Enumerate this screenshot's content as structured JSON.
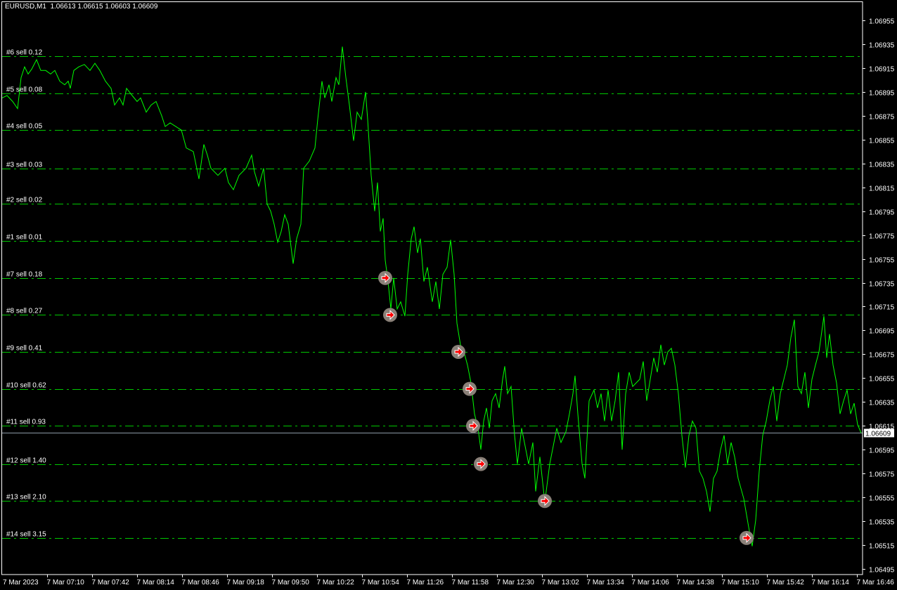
{
  "header": {
    "symbol": "EURUSD,M1",
    "ohlc": "1.06613 1.06615 1.06603 1.06609"
  },
  "colors": {
    "background": "#000000",
    "price_line": "#00ff00",
    "order_line": "#00c800",
    "axis": "#ffffff",
    "bid_line": "#8c9aa6",
    "marker_fill": "#8a8078",
    "marker_arrow": "#ff0000"
  },
  "chart_data": {
    "type": "line",
    "title": "EURUSD,M1",
    "x_unit": "minutes after 7 Mar 2023 06:38",
    "xlim": [
      0,
      611
    ],
    "ylim": [
      1.06485,
      1.06972
    ],
    "grid": false,
    "current_price": "1.06609",
    "y_ticks": [
      "1.06955",
      "1.06935",
      "1.06915",
      "1.06895",
      "1.06875",
      "1.06855",
      "1.06835",
      "1.06815",
      "1.06795",
      "1.06775",
      "1.06755",
      "1.06735",
      "1.06715",
      "1.06695",
      "1.06675",
      "1.06655",
      "1.06635",
      "1.06615",
      "1.06595",
      "1.06575",
      "1.06555",
      "1.06535",
      "1.06515",
      "1.06495"
    ],
    "x_ticks": [
      {
        "t": 0,
        "label": "7 Mar 2023"
      },
      {
        "t": 32,
        "label": "7 Mar 07:10"
      },
      {
        "t": 64,
        "label": "7 Mar 07:42"
      },
      {
        "t": 96,
        "label": "7 Mar 08:14"
      },
      {
        "t": 128,
        "label": "7 Mar 08:46"
      },
      {
        "t": 160,
        "label": "7 Mar 09:18"
      },
      {
        "t": 192,
        "label": "7 Mar 09:50"
      },
      {
        "t": 224,
        "label": "7 Mar 10:22"
      },
      {
        "t": 256,
        "label": "7 Mar 10:54"
      },
      {
        "t": 288,
        "label": "7 Mar 11:26"
      },
      {
        "t": 320,
        "label": "7 Mar 11:58"
      },
      {
        "t": 352,
        "label": "7 Mar 12:30"
      },
      {
        "t": 384,
        "label": "7 Mar 13:02"
      },
      {
        "t": 416,
        "label": "7 Mar 13:34"
      },
      {
        "t": 448,
        "label": "7 Mar 14:06"
      },
      {
        "t": 480,
        "label": "7 Mar 14:38"
      },
      {
        "t": 512,
        "label": "7 Mar 15:10"
      },
      {
        "t": 544,
        "label": "7 Mar 15:42"
      },
      {
        "t": 576,
        "label": "7 Mar 16:14"
      },
      {
        "t": 608,
        "label": "7 Mar 16:46"
      }
    ],
    "orders": [
      {
        "label": "#6 sell 0.12",
        "price": 1.06925
      },
      {
        "label": "#5 sell 0.08",
        "price": 1.06894
      },
      {
        "label": "#4 sell 0.05",
        "price": 1.06863
      },
      {
        "label": "#3 sell 0.03",
        "price": 1.06831
      },
      {
        "label": "#2 sell 0.02",
        "price": 1.06801
      },
      {
        "label": "#1 sell 0.01",
        "price": 1.0677
      },
      {
        "label": "#7 sell 0.18",
        "price": 1.06739
      },
      {
        "label": "#8 sell 0.27",
        "price": 1.06708
      },
      {
        "label": "#9 sell 0.41",
        "price": 1.06677
      },
      {
        "label": "#10 sell 0.62",
        "price": 1.06646
      },
      {
        "label": "#11 sell 0.93",
        "price": 1.06615
      },
      {
        "label": "#12 sell 1.40",
        "price": 1.06583
      },
      {
        "label": "#13 sell 2.10",
        "price": 1.06552
      },
      {
        "label": "#14 sell 3.15",
        "price": 1.06521
      }
    ],
    "entries": [
      {
        "t": 272.5,
        "price": 1.06739
      },
      {
        "t": 276,
        "price": 1.06708
      },
      {
        "t": 324.5,
        "price": 1.06677
      },
      {
        "t": 332.5,
        "price": 1.06646
      },
      {
        "t": 335,
        "price": 1.06615
      },
      {
        "t": 340.5,
        "price": 1.06583
      },
      {
        "t": 386,
        "price": 1.06552
      },
      {
        "t": 529.5,
        "price": 1.06521
      }
    ],
    "series": [
      {
        "name": "EURUSD close",
        "points": [
          [
            0,
            1.0689
          ],
          [
            3.5,
            1.06892
          ],
          [
            7.5,
            1.06887
          ],
          [
            11,
            1.06881
          ],
          [
            13.5,
            1.06907
          ],
          [
            16,
            1.06916
          ],
          [
            18.5,
            1.0691
          ],
          [
            21,
            1.06914
          ],
          [
            24.5,
            1.06922
          ],
          [
            27.5,
            1.06913
          ],
          [
            31,
            1.06913
          ],
          [
            34.5,
            1.0691
          ],
          [
            37.5,
            1.06913
          ],
          [
            41,
            1.06904
          ],
          [
            44.5,
            1.06901
          ],
          [
            47,
            1.06904
          ],
          [
            48.5,
            1.06898
          ],
          [
            51,
            1.06913
          ],
          [
            54.5,
            1.06916
          ],
          [
            58.5,
            1.06918
          ],
          [
            62.5,
            1.06913
          ],
          [
            66,
            1.06919
          ],
          [
            69.5,
            1.06913
          ],
          [
            73.5,
            1.06904
          ],
          [
            77.5,
            1.06898
          ],
          [
            80,
            1.06884
          ],
          [
            83.5,
            1.0689
          ],
          [
            86,
            1.06884
          ],
          [
            88.5,
            1.06898
          ],
          [
            92.5,
            1.06892
          ],
          [
            96,
            1.06887
          ],
          [
            98.5,
            1.0689
          ],
          [
            102.5,
            1.06878
          ],
          [
            106,
            1.06884
          ],
          [
            109.5,
            1.06887
          ],
          [
            113.5,
            1.06875
          ],
          [
            116,
            1.06866
          ],
          [
            119.5,
            1.06869
          ],
          [
            123.5,
            1.06866
          ],
          [
            127.5,
            1.06863
          ],
          [
            131,
            1.06848
          ],
          [
            136,
            1.06845
          ],
          [
            140,
            1.06822
          ],
          [
            143.5,
            1.06851
          ],
          [
            146,
            1.06842
          ],
          [
            148.5,
            1.06831
          ],
          [
            153.5,
            1.06825
          ],
          [
            158.5,
            1.06831
          ],
          [
            161,
            1.06819
          ],
          [
            164.5,
            1.06813
          ],
          [
            168.5,
            1.06825
          ],
          [
            173.5,
            1.06831
          ],
          [
            177.5,
            1.06842
          ],
          [
            179.5,
            1.06828
          ],
          [
            182.5,
            1.06816
          ],
          [
            186,
            1.06831
          ],
          [
            188.5,
            1.06801
          ],
          [
            191,
            1.06795
          ],
          [
            193.5,
            1.06784
          ],
          [
            196,
            1.06769
          ],
          [
            198.5,
            1.06778
          ],
          [
            201,
            1.06792
          ],
          [
            203.5,
            1.06784
          ],
          [
            207,
            1.06751
          ],
          [
            209.5,
            1.06772
          ],
          [
            212.5,
            1.06784
          ],
          [
            214.5,
            1.06831
          ],
          [
            218.5,
            1.06837
          ],
          [
            222.5,
            1.06848
          ],
          [
            224.5,
            1.06872
          ],
          [
            227.5,
            1.06904
          ],
          [
            229.5,
            1.0689
          ],
          [
            232.5,
            1.06901
          ],
          [
            234.5,
            1.06887
          ],
          [
            237.5,
            1.06907
          ],
          [
            239.5,
            1.06901
          ],
          [
            242,
            1.06933
          ],
          [
            244.5,
            1.06907
          ],
          [
            247,
            1.06884
          ],
          [
            250,
            1.06854
          ],
          [
            252.5,
            1.06878
          ],
          [
            255.5,
            1.06872
          ],
          [
            258.5,
            1.06895
          ],
          [
            260,
            1.06872
          ],
          [
            262.5,
            1.06825
          ],
          [
            265,
            1.06795
          ],
          [
            267,
            1.06819
          ],
          [
            269,
            1.06778
          ],
          [
            271,
            1.06789
          ],
          [
            272.5,
            1.06754
          ],
          [
            274.5,
            1.06736
          ],
          [
            276.5,
            1.06713
          ],
          [
            278.5,
            1.06739
          ],
          [
            281,
            1.06713
          ],
          [
            283.5,
            1.06719
          ],
          [
            286.5,
            1.06707
          ],
          [
            288.5,
            1.06742
          ],
          [
            291,
            1.06772
          ],
          [
            293,
            1.06782
          ],
          [
            295.5,
            1.0676
          ],
          [
            297.5,
            1.06772
          ],
          [
            300,
            1.06736
          ],
          [
            302.5,
            1.06748
          ],
          [
            306,
            1.06719
          ],
          [
            308.5,
            1.06736
          ],
          [
            311,
            1.06713
          ],
          [
            313.5,
            1.06742
          ],
          [
            316.5,
            1.06748
          ],
          [
            319,
            1.06771
          ],
          [
            321.5,
            1.06742
          ],
          [
            323.5,
            1.06701
          ],
          [
            326,
            1.06683
          ],
          [
            328.5,
            1.06677
          ],
          [
            331,
            1.06666
          ],
          [
            333.5,
            1.06651
          ],
          [
            336,
            1.06625
          ],
          [
            338.5,
            1.06613
          ],
          [
            340.5,
            1.06595
          ],
          [
            342.5,
            1.06619
          ],
          [
            344.5,
            1.0663
          ],
          [
            346.5,
            1.06613
          ],
          [
            348.5,
            1.06636
          ],
          [
            351,
            1.06642
          ],
          [
            353.5,
            1.0663
          ],
          [
            356,
            1.06654
          ],
          [
            357.5,
            1.06665
          ],
          [
            359.5,
            1.06642
          ],
          [
            362,
            1.06648
          ],
          [
            364.5,
            1.06607
          ],
          [
            366.5,
            1.06583
          ],
          [
            369.5,
            1.06613
          ],
          [
            372.5,
            1.06595
          ],
          [
            374.5,
            1.06583
          ],
          [
            377.5,
            1.06601
          ],
          [
            379.5,
            1.0656
          ],
          [
            382.5,
            1.06589
          ],
          [
            386,
            1.06551
          ],
          [
            389.5,
            1.06583
          ],
          [
            392.5,
            1.06601
          ],
          [
            394.5,
            1.06613
          ],
          [
            397.5,
            1.06601
          ],
          [
            401,
            1.0661
          ],
          [
            403.5,
            1.06625
          ],
          [
            406,
            1.06642
          ],
          [
            407.5,
            1.06657
          ],
          [
            409.5,
            1.06625
          ],
          [
            412.5,
            1.06583
          ],
          [
            414.5,
            1.06571
          ],
          [
            417.5,
            1.06636
          ],
          [
            421,
            1.06645
          ],
          [
            423.5,
            1.0663
          ],
          [
            426,
            1.06642
          ],
          [
            428.5,
            1.06619
          ],
          [
            431,
            1.06645
          ],
          [
            433.5,
            1.06619
          ],
          [
            436,
            1.06636
          ],
          [
            438.5,
            1.0666
          ],
          [
            441,
            1.06595
          ],
          [
            443.5,
            1.06642
          ],
          [
            446,
            1.0666
          ],
          [
            448.5,
            1.06648
          ],
          [
            451,
            1.06651
          ],
          [
            453.5,
            1.06654
          ],
          [
            456,
            1.06669
          ],
          [
            458.5,
            1.06636
          ],
          [
            461,
            1.06654
          ],
          [
            463.5,
            1.06672
          ],
          [
            466,
            1.0666
          ],
          [
            468.5,
            1.06683
          ],
          [
            471,
            1.06666
          ],
          [
            473.5,
            1.06677
          ],
          [
            476,
            1.0668
          ],
          [
            478.5,
            1.06666
          ],
          [
            481,
            1.06642
          ],
          [
            483.5,
            1.06607
          ],
          [
            486,
            1.0658
          ],
          [
            488.5,
            1.06607
          ],
          [
            491,
            1.06619
          ],
          [
            493.5,
            1.06613
          ],
          [
            496,
            1.06577
          ],
          [
            498.5,
            1.06571
          ],
          [
            501,
            1.0656
          ],
          [
            503.5,
            1.06543
          ],
          [
            506,
            1.06571
          ],
          [
            508.5,
            1.06577
          ],
          [
            511,
            1.06595
          ],
          [
            513.5,
            1.06607
          ],
          [
            516,
            1.06583
          ],
          [
            518.5,
            1.06601
          ],
          [
            521,
            1.06589
          ],
          [
            523.5,
            1.06571
          ],
          [
            527.5,
            1.06554
          ],
          [
            531,
            1.0653
          ],
          [
            533.5,
            1.06514
          ],
          [
            536,
            1.06536
          ],
          [
            538.5,
            1.06577
          ],
          [
            541,
            1.06607
          ],
          [
            543.5,
            1.06619
          ],
          [
            546,
            1.06636
          ],
          [
            548.5,
            1.06648
          ],
          [
            551,
            1.06619
          ],
          [
            553.5,
            1.06642
          ],
          [
            556,
            1.06654
          ],
          [
            558.5,
            1.06666
          ],
          [
            561,
            1.06689
          ],
          [
            563.5,
            1.06704
          ],
          [
            566,
            1.06648
          ],
          [
            568.5,
            1.06642
          ],
          [
            571,
            1.0666
          ],
          [
            573.5,
            1.0663
          ],
          [
            576,
            1.06654
          ],
          [
            578.5,
            1.06666
          ],
          [
            581,
            1.06677
          ],
          [
            584.5,
            1.06707
          ],
          [
            586.5,
            1.06672
          ],
          [
            588.5,
            1.06692
          ],
          [
            591,
            1.06666
          ],
          [
            593.5,
            1.06651
          ],
          [
            596,
            1.06625
          ],
          [
            598.5,
            1.06636
          ],
          [
            601,
            1.06645
          ],
          [
            603.5,
            1.06625
          ],
          [
            606,
            1.06634
          ],
          [
            608.5,
            1.06616
          ],
          [
            611,
            1.06609
          ]
        ]
      }
    ]
  }
}
